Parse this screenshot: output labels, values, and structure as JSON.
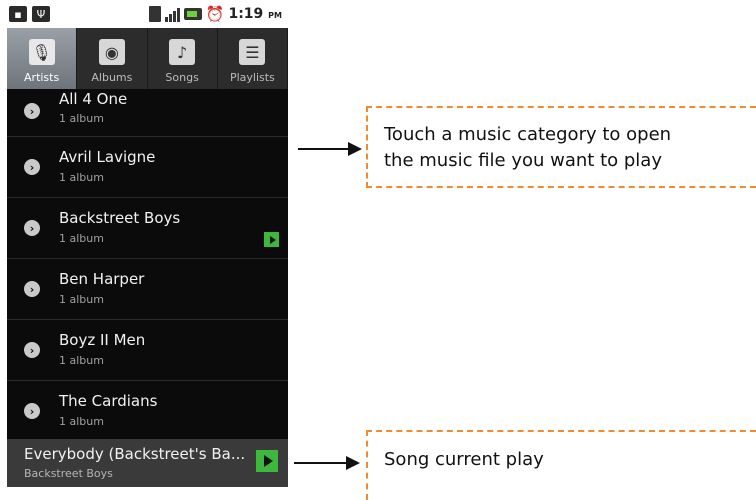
{
  "status_bar": {
    "time": "1:19",
    "ampm": "PM"
  },
  "tabs": [
    {
      "label": "Artists",
      "icon": "microphone-icon",
      "active": true
    },
    {
      "label": "Albums",
      "icon": "album-icon",
      "active": false
    },
    {
      "label": "Songs",
      "icon": "music-note-icon",
      "active": false
    },
    {
      "label": "Playlists",
      "icon": "playlist-icon",
      "active": false
    }
  ],
  "artists": [
    {
      "name": "All 4 One",
      "sub": "1 album",
      "playing": false
    },
    {
      "name": "Avril Lavigne",
      "sub": "1 album",
      "playing": false
    },
    {
      "name": "Backstreet Boys",
      "sub": "1 album",
      "playing": true
    },
    {
      "name": "Ben Harper",
      "sub": "1 album",
      "playing": false
    },
    {
      "name": "Boyz II Men",
      "sub": "1 album",
      "playing": false
    },
    {
      "name": "The Cardians",
      "sub": "1 album",
      "playing": false
    }
  ],
  "now_playing": {
    "title": "Everybody (Backstreet's Ba...",
    "artist": "Backstreet Boys"
  },
  "annotations": {
    "callout_top": "Touch a music category to open the music file you want to play",
    "callout_top_line1": "Touch a music category to open",
    "callout_top_line2": "the music file you want to play",
    "callout_bottom": "Song current play"
  },
  "colors": {
    "accent_play": "#3db83d",
    "callout_border": "#f28a2e"
  }
}
